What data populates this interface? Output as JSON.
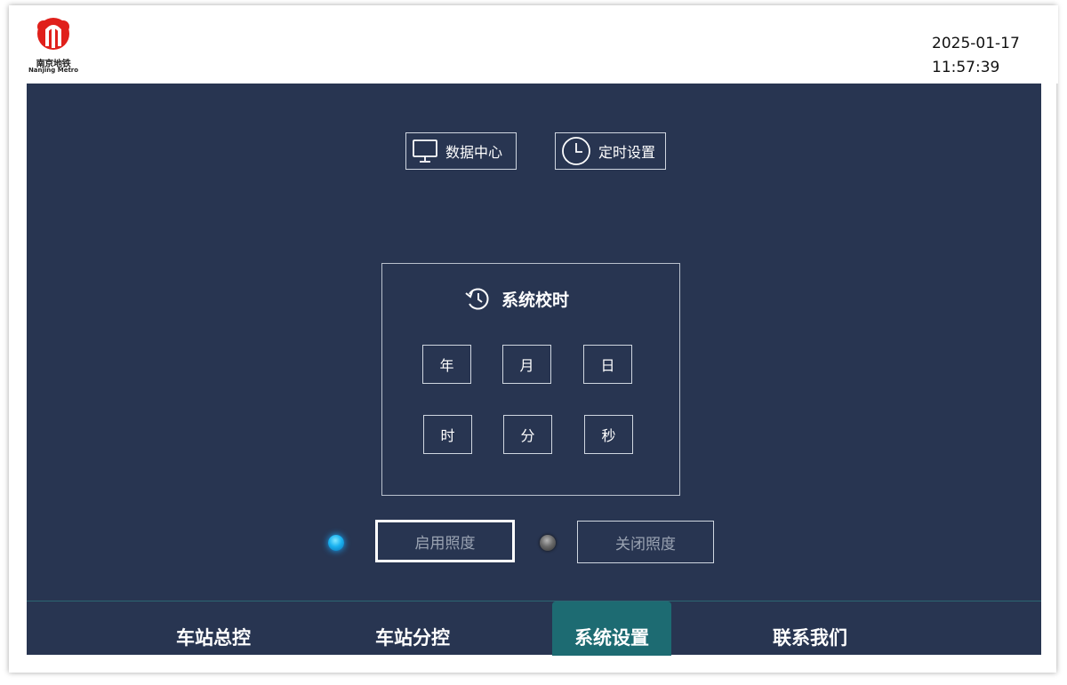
{
  "header": {
    "logo_text": "南京地铁",
    "logo_subtext": "Nanjing Metro",
    "date": "2025-01-17",
    "time": "11:57:39"
  },
  "top_buttons": {
    "data_center": "数据中心",
    "timer_settings": "定时设置"
  },
  "calibration": {
    "title": "系统校时",
    "fields": {
      "year": "年",
      "month": "月",
      "day": "日",
      "hour": "时",
      "minute": "分",
      "second": "秒"
    }
  },
  "lighting": {
    "enable_label": "启用照度",
    "disable_label": "关闭照度",
    "enabled": true
  },
  "tabs": [
    {
      "label": "车站总控"
    },
    {
      "label": "车站分控"
    },
    {
      "label": "系统设置",
      "selected": true
    },
    {
      "label": "联系我们"
    }
  ],
  "colors": {
    "background": "#283551",
    "selected_tab": "#1d6b72",
    "logo_red": "#e0201b",
    "indicator_on": "#1ab2f0"
  }
}
